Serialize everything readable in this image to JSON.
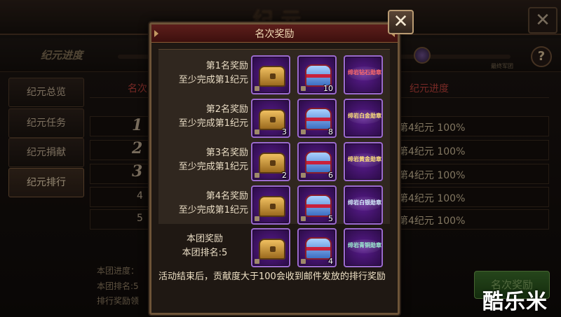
{
  "background": {
    "title": "纪元",
    "close_icon": "✕",
    "progress_label": "纪元进度",
    "progress_end_label": "最终军团",
    "help_icon": "?",
    "sidebar": [
      {
        "label": "纪元总览",
        "active": false
      },
      {
        "label": "纪元任务",
        "active": false
      },
      {
        "label": "纪元捐献",
        "active": false
      },
      {
        "label": "纪元排行",
        "active": true
      }
    ],
    "table": {
      "headers": {
        "rank": "名次",
        "progress": "纪元进度"
      },
      "rows": [
        {
          "rank": "1",
          "progress": "第4纪元 100%"
        },
        {
          "rank": "2",
          "progress": "第4纪元 100%"
        },
        {
          "rank": "3",
          "progress": "第4纪元 100%"
        },
        {
          "rank": "4",
          "progress": "第4纪元 100%"
        },
        {
          "rank": "5",
          "progress": "第4纪元 100%"
        }
      ]
    },
    "footer": {
      "team_progress": "本团进度：",
      "team_rank": "本团排名:5",
      "rank_reward": "排行奖励领",
      "rank_reward_button": "名次奖励"
    },
    "watermark": "酷乐米"
  },
  "modal": {
    "title": "名次奖励",
    "close_icon": "✕",
    "rewards": [
      {
        "label_1": "第1名奖励",
        "label_2": "至少完成第1纪元",
        "items": [
          {
            "icon": "gold-chest",
            "count": ""
          },
          {
            "icon": "blue-chest",
            "count": "10"
          },
          {
            "icon": "badge",
            "badge_text": "绯岩钻石勋章",
            "count": ""
          }
        ]
      },
      {
        "label_1": "第2名奖励",
        "label_2": "至少完成第1纪元",
        "items": [
          {
            "icon": "gold-chest",
            "count": "3"
          },
          {
            "icon": "blue-chest",
            "count": "8"
          },
          {
            "icon": "badge",
            "badge_text": "绯岩白金勋章",
            "count": ""
          }
        ]
      },
      {
        "label_1": "第3名奖励",
        "label_2": "至少完成第1纪元",
        "items": [
          {
            "icon": "gold-chest",
            "count": "2"
          },
          {
            "icon": "blue-chest",
            "count": "6"
          },
          {
            "icon": "badge",
            "badge_text": "绯岩黄金勋章",
            "count": ""
          }
        ]
      },
      {
        "label_1": "第4名奖励",
        "label_2": "至少完成第1纪元",
        "items": [
          {
            "icon": "gold-chest",
            "count": ""
          },
          {
            "icon": "blue-chest",
            "count": "5"
          },
          {
            "icon": "badge",
            "badge_text": "绯岩白银勋章",
            "count": ""
          }
        ]
      }
    ],
    "own_reward": {
      "label_1": "本团奖励",
      "label_2": "本团排名:5",
      "items": [
        {
          "icon": "gold-chest",
          "count": ""
        },
        {
          "icon": "blue-chest",
          "count": "4"
        },
        {
          "icon": "badge",
          "badge_text": "绯岩青铜勋章",
          "count": ""
        }
      ]
    },
    "notice": "活动结束后，贡献度大于100会收到邮件发放的排行奖励"
  },
  "colors": {
    "accent_red": "#b7403a",
    "slot_purple": "#5a1c8f",
    "header_red": "#5d1e1b"
  }
}
